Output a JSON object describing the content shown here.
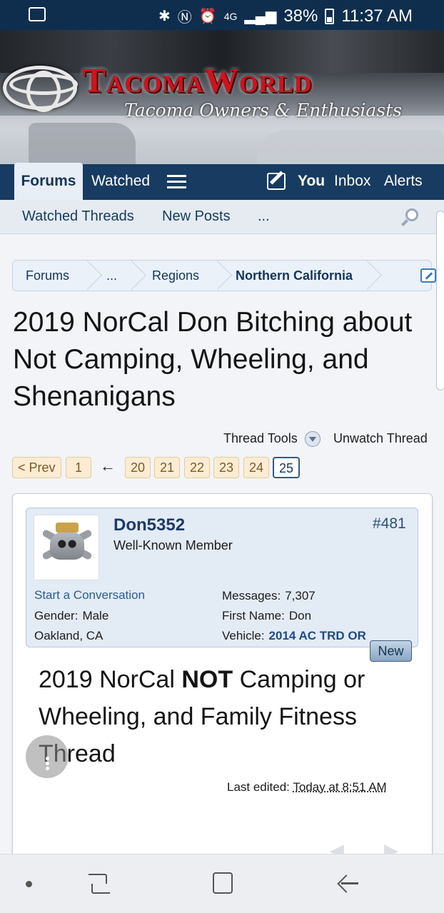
{
  "status_bar": {
    "battery": "38%",
    "time": "11:37 AM",
    "network": "4G"
  },
  "banner": {
    "logo_text": "TacomaWorld",
    "tagline": "Tacoma Owners & Enthusiasts"
  },
  "nav": {
    "forums": "Forums",
    "watched": "Watched",
    "you": "You",
    "inbox": "Inbox",
    "alerts": "Alerts"
  },
  "subnav": {
    "watched_threads": "Watched Threads",
    "new_posts": "New Posts",
    "more": "..."
  },
  "breadcrumb": [
    "Forums",
    "...",
    "Regions",
    "Northern California"
  ],
  "thread": {
    "title": "2019 NorCal Don Bitching about Not Camping, Wheeling, and Shenanigans",
    "thread_tools": "Thread Tools",
    "unwatch": "Unwatch Thread"
  },
  "pagination": {
    "prev": "< Prev",
    "first": "1",
    "arrow": "←",
    "pages": [
      "20",
      "21",
      "22",
      "23",
      "24"
    ],
    "current": "25"
  },
  "post": {
    "username": "Don5352",
    "user_title": "Well-Known Member",
    "post_number": "#481",
    "start_conversation": "Start a Conversation",
    "gender_label": "Gender:",
    "gender": "Male",
    "location": "Oakland, CA",
    "messages_label": "Messages:",
    "messages": "7,307",
    "first_name_label": "First Name:",
    "first_name": "Don",
    "vehicle_label": "Vehicle:",
    "vehicle": "2014 AC TRD OR",
    "new_badge": "New",
    "message_part1": "2019 NorCal ",
    "message_bold": "NOT",
    "message_part2": " Camping or Wheeling, and Family Fitness Thread",
    "last_edited_label": "Last edited:",
    "last_edited_time": "Today at 8:51 AM"
  },
  "colors": {
    "header_navy": "#173b61",
    "status_bar": "#0f2e4e",
    "logo_red": "#d0121b",
    "pager_bg": "#fcecd2"
  }
}
